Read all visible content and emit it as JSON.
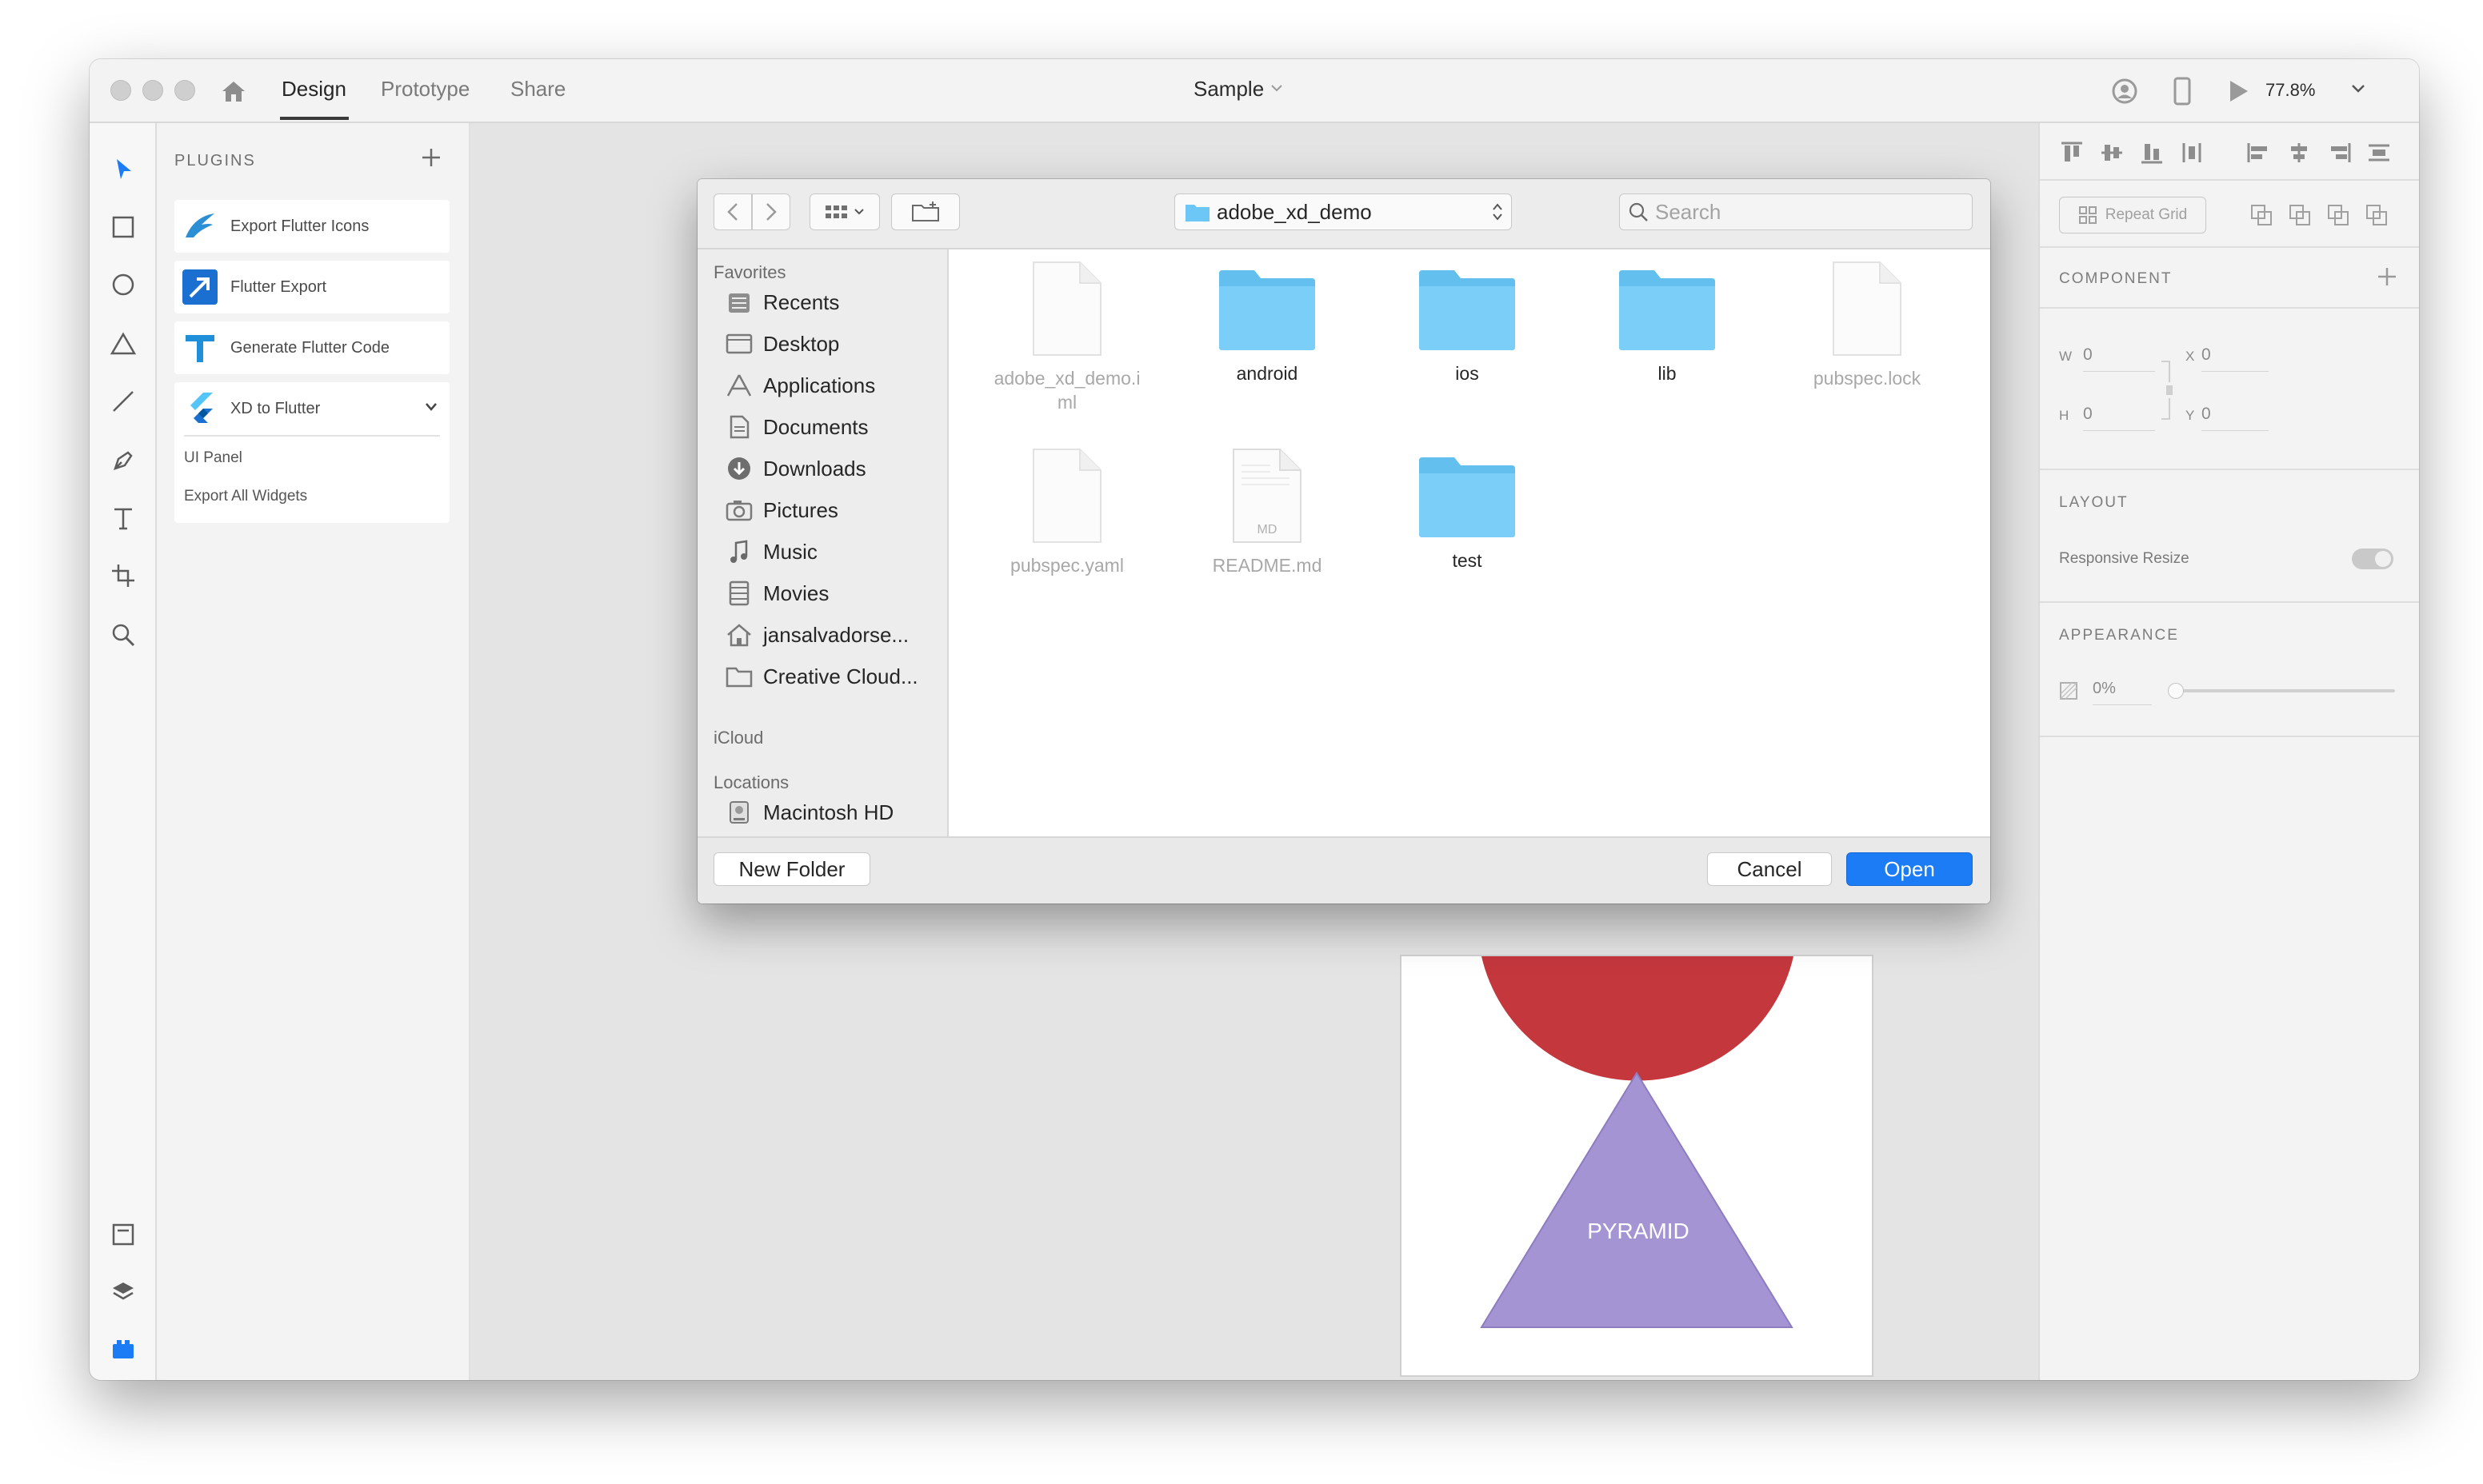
{
  "titlebar": {
    "tabs": [
      "Design",
      "Prototype",
      "Share"
    ],
    "active_tab": "Design",
    "document_title": "Sample",
    "zoom": "77.8%"
  },
  "plugins_panel": {
    "title": "PLUGINS",
    "items": [
      {
        "label": "Export Flutter Icons",
        "icon": "flutter-icons-plugin-icon"
      },
      {
        "label": "Flutter Export",
        "icon": "flutter-export-plugin-icon"
      },
      {
        "label": "Generate Flutter Code",
        "icon": "generate-flutter-code-plugin-icon"
      },
      {
        "label": "XD to Flutter",
        "icon": "flutter-logo-icon"
      }
    ],
    "xd_to_flutter_menu": [
      "UI Panel",
      "Export All Widgets"
    ]
  },
  "artboard": {
    "shape_label": "PYRAMID",
    "circle_color": "#c4373d",
    "triangle_color": "#a594d4"
  },
  "right_panel": {
    "repeat_grid": "Repeat Grid",
    "component_title": "COMPONENT",
    "w_label": "W",
    "w_value": "0",
    "h_label": "H",
    "h_value": "0",
    "x_label": "X",
    "x_value": "0",
    "y_label": "Y",
    "y_value": "0",
    "layout_title": "LAYOUT",
    "responsive_resize": "Responsive Resize",
    "appearance_title": "APPEARANCE",
    "opacity": "0%"
  },
  "dialog": {
    "location": "adobe_xd_demo",
    "search_placeholder": "Search",
    "sidebar": {
      "favorites_title": "Favorites",
      "favorites": [
        {
          "label": "Recents",
          "icon": "recents-icon"
        },
        {
          "label": "Desktop",
          "icon": "desktop-icon"
        },
        {
          "label": "Applications",
          "icon": "applications-icon"
        },
        {
          "label": "Documents",
          "icon": "documents-icon"
        },
        {
          "label": "Downloads",
          "icon": "downloads-icon"
        },
        {
          "label": "Pictures",
          "icon": "pictures-icon"
        },
        {
          "label": "Music",
          "icon": "music-icon"
        },
        {
          "label": "Movies",
          "icon": "movies-icon"
        },
        {
          "label": "jansalvadorse...",
          "icon": "home-icon"
        },
        {
          "label": "Creative Cloud...",
          "icon": "folder-icon"
        }
      ],
      "icloud_title": "iCloud",
      "locations_title": "Locations",
      "locations": [
        {
          "label": "Macintosh HD",
          "icon": "hard-disk-icon"
        }
      ]
    },
    "files": [
      {
        "name": "adobe_xd_demo.i\nml",
        "type": "file",
        "enabled": false
      },
      {
        "name": "android",
        "type": "folder",
        "enabled": true
      },
      {
        "name": "ios",
        "type": "folder",
        "enabled": true
      },
      {
        "name": "lib",
        "type": "folder",
        "enabled": true
      },
      {
        "name": "pubspec.lock",
        "type": "file",
        "enabled": false
      },
      {
        "name": "pubspec.yaml",
        "type": "file",
        "enabled": false
      },
      {
        "name": "README.md",
        "type": "markdown",
        "badge": "MD",
        "enabled": false
      },
      {
        "name": "test",
        "type": "folder",
        "enabled": true
      }
    ],
    "new_folder": "New Folder",
    "cancel": "Cancel",
    "open": "Open",
    "accent_color": "#1b7cf6",
    "folder_color": "#6cc7f6"
  }
}
